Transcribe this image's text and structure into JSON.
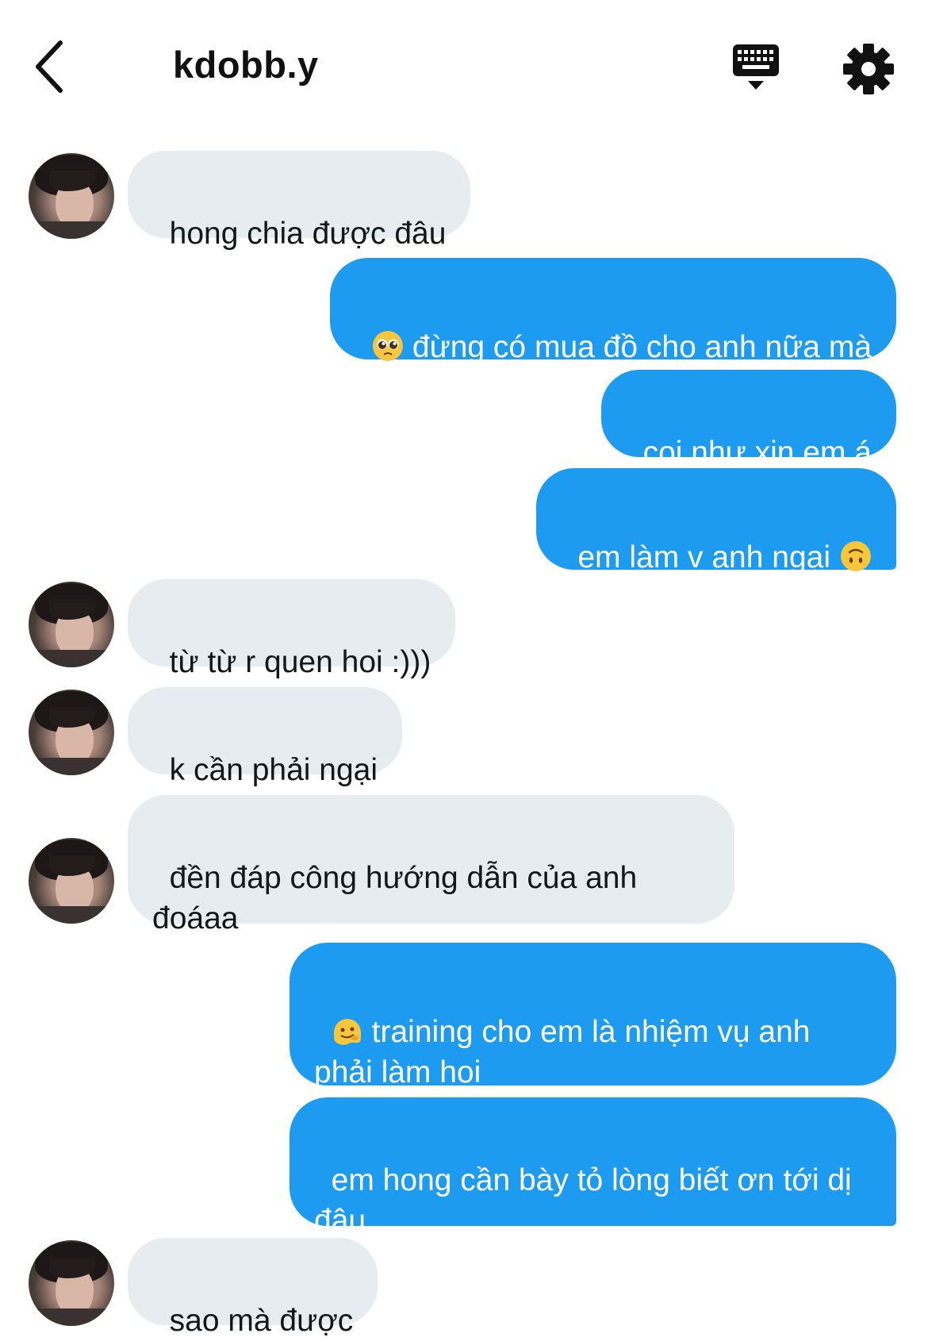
{
  "header": {
    "back_icon": "chevron-left-icon",
    "title": "kdobb.y",
    "keyboard_icon": "keyboard-icon",
    "settings_icon": "gear-icon"
  },
  "colors": {
    "outgoing_bubble": "#1d9bf0",
    "incoming_bubble": "#e6ecf0",
    "outgoing_text": "#ffffff",
    "incoming_text": "#14171a"
  },
  "messages": [
    {
      "side": "in",
      "text": "hong chia được đâu"
    },
    {
      "side": "out",
      "emoji": "pleading-face-emoji",
      "text": "đừng có mua đồ cho anh nữa mà"
    },
    {
      "side": "out",
      "text": "coi như xin em á"
    },
    {
      "side": "out",
      "text": "em làm v anh ngại",
      "emoji_after": "upside-down-face-emoji"
    },
    {
      "side": "in",
      "text": "từ từ r quen hoi :)))"
    },
    {
      "side": "in",
      "text": "k cần phải ngại"
    },
    {
      "side": "in",
      "text": "đền đáp công hướng dẫn của anh đoáaa"
    },
    {
      "side": "out",
      "emoji": "melting-face-emoji",
      "text": "training cho em là nhiệm vụ anh phải làm hoi"
    },
    {
      "side": "out",
      "text": "em hong cần bày tỏ lòng biết ơn tới dị đâu"
    },
    {
      "side": "in",
      "text": "sao mà được"
    }
  ]
}
